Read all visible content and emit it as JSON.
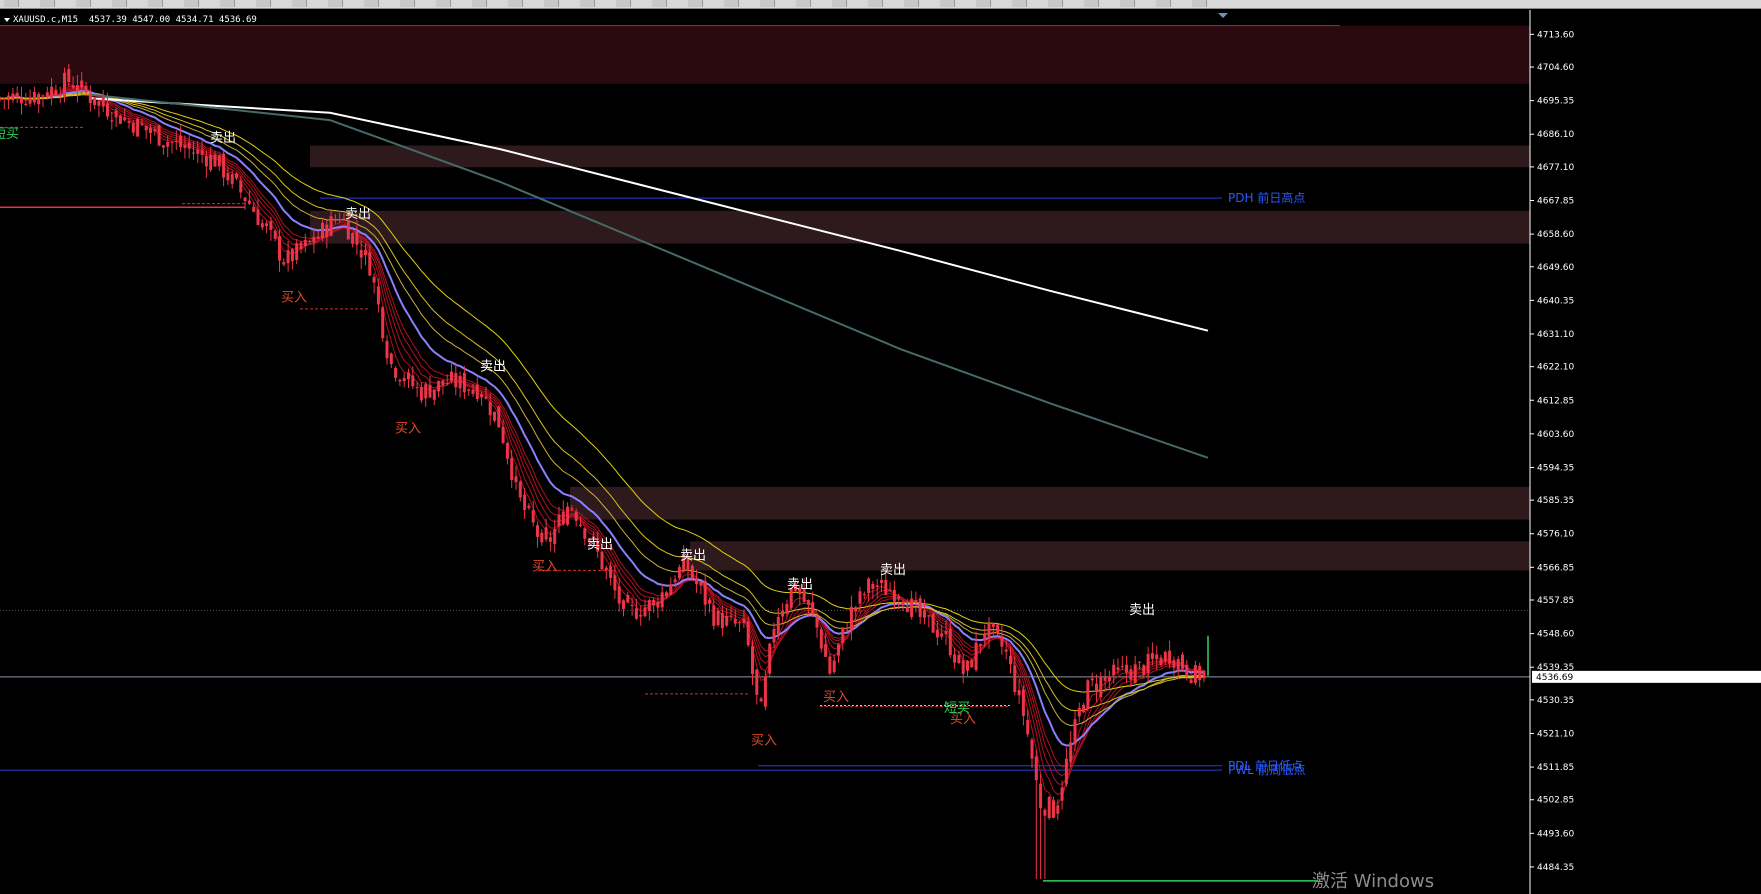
{
  "toolbar": {
    "buttons": 34
  },
  "info": {
    "symbol": "XAUUSD.c,M15",
    "ohlc": "4537.39 4547.00 4534.71 4536.69"
  },
  "chart_data": {
    "type": "candlestick",
    "y_min": 4478,
    "y_max": 4717,
    "y_ticks": [
      "4713.60",
      "4704.60",
      "4695.35",
      "4686.10",
      "4677.10",
      "4667.85",
      "4658.60",
      "4649.60",
      "4640.35",
      "4631.10",
      "4622.10",
      "4612.85",
      "4603.60",
      "4594.35",
      "4585.35",
      "4576.10",
      "4566.85",
      "4557.85",
      "4548.60",
      "4539.35",
      "4530.35",
      "4521.10",
      "4511.85",
      "4502.85",
      "4493.60",
      "4484.35"
    ],
    "current_price": "4536.69",
    "zones": [
      {
        "top": 4716,
        "bottom": 4700,
        "color": "#2a0a0e",
        "x0": 0,
        "x1": 1530
      },
      {
        "top": 4683,
        "bottom": 4677,
        "color": "#2e1a1c",
        "x0": 310,
        "x1": 1530
      },
      {
        "top": 4665,
        "bottom": 4656,
        "color": "#2e1a1c",
        "x0": 310,
        "x1": 1530
      },
      {
        "top": 4589,
        "bottom": 4580,
        "color": "#2e1a1c",
        "x0": 570,
        "x1": 1530
      },
      {
        "top": 4574,
        "bottom": 4566,
        "color": "#2e1a1c",
        "x0": 690,
        "x1": 1530
      }
    ],
    "levels": [
      {
        "price": 4668.5,
        "color": "#2a3be0",
        "x0": 320,
        "x1": 1222,
        "label": "PDH 前日高点"
      },
      {
        "price": 4512.2,
        "color": "#2a3be0",
        "x0": 758,
        "x1": 1222,
        "label": "PDL 前日低点"
      },
      {
        "price": 4511.0,
        "color": "#2a3be0",
        "x0": 0,
        "x1": 1222,
        "label": "PWL 前周低点"
      }
    ],
    "signals": [
      {
        "text": "卖出",
        "x": 223,
        "price": 4684,
        "color": "#ffffff"
      },
      {
        "text": "卖出",
        "x": 358,
        "price": 4663,
        "color": "#ffffff"
      },
      {
        "text": "卖出",
        "x": 493,
        "price": 4621,
        "color": "#ffffff"
      },
      {
        "text": "卖出",
        "x": 600,
        "price": 4572,
        "color": "#ffffff"
      },
      {
        "text": "卖出",
        "x": 693,
        "price": 4569,
        "color": "#ffffff"
      },
      {
        "text": "卖出",
        "x": 800,
        "price": 4561,
        "color": "#ffffff"
      },
      {
        "text": "卖出",
        "x": 893,
        "price": 4565,
        "color": "#ffffff"
      },
      {
        "text": "卖出",
        "x": 1142,
        "price": 4554,
        "color": "#ffffff"
      },
      {
        "text": "买入",
        "x": 294,
        "price": 4640,
        "color": "#e04a2a"
      },
      {
        "text": "买入",
        "x": 408,
        "price": 4604,
        "color": "#e04a2a"
      },
      {
        "text": "买入",
        "x": 545,
        "price": 4566,
        "color": "#e04a2a"
      },
      {
        "text": "买入",
        "x": 836,
        "price": 4530,
        "color": "#e04a2a"
      },
      {
        "text": "买入",
        "x": 764,
        "price": 4518,
        "color": "#e04a2a"
      },
      {
        "text": "买入",
        "x": 963,
        "price": 4524,
        "color": "#e04a2a"
      },
      {
        "text": "短买",
        "x": 6,
        "price": 4685,
        "color": "#2fd05a"
      },
      {
        "text": "短买",
        "x": 957,
        "price": 4527,
        "color": "#2fd05a"
      }
    ],
    "watermark": "激活 Windows"
  }
}
